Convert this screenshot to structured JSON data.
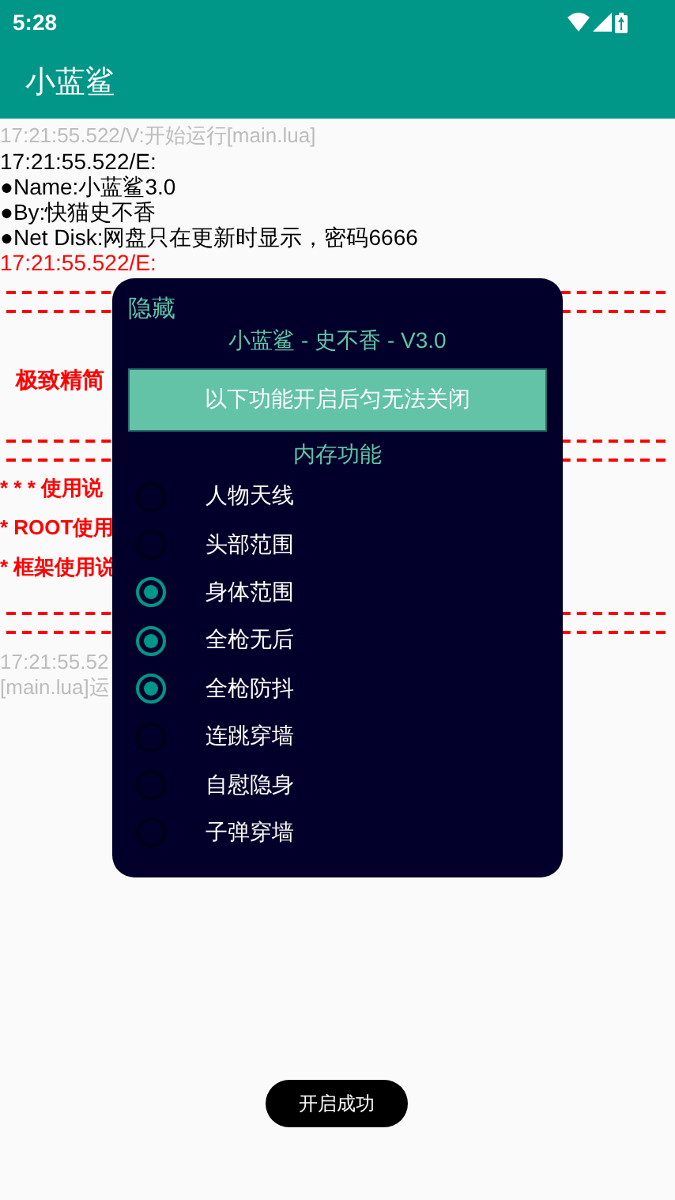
{
  "status_bar": {
    "time": "5:28"
  },
  "app_bar": {
    "title": "小蓝鲨"
  },
  "log": [
    {
      "kind": "info",
      "text": "17:21:55.522/V:开始运行[main.lua]"
    },
    {
      "kind": "plain",
      "text": "17:21:55.522/E:"
    },
    {
      "kind": "plain",
      "text": "●Name:小蓝鲨3.0"
    },
    {
      "kind": "plain",
      "text": "●By:快猫史不香"
    },
    {
      "kind": "plain",
      "text": "●Net Disk:网盘只在更新时显示，密码6666"
    },
    {
      "kind": "error",
      "text": "17:21:55.522/E:"
    },
    {
      "kind": "dashes"
    },
    {
      "kind": "note",
      "text": "极致精简"
    },
    {
      "kind": "dashes"
    },
    {
      "kind": "bullet",
      "text": "* * * 使用说"
    },
    {
      "kind": "bullet",
      "text": "* ROOT使用"
    },
    {
      "kind": "bullet",
      "text": "* 框架使用说"
    },
    {
      "kind": "dashes"
    },
    {
      "kind": "info",
      "text": "17:21:55.52"
    },
    {
      "kind": "info",
      "text": "[main.lua]运"
    }
  ],
  "dialog": {
    "hide": "隐藏",
    "title": "小蓝鲨 - 史不香 - V3.0",
    "banner": "以下功能开启后匀无法关闭",
    "section": "内存功能",
    "options": [
      {
        "label": "人物天线",
        "selected": false
      },
      {
        "label": "头部范围",
        "selected": false
      },
      {
        "label": "身体范围",
        "selected": true
      },
      {
        "label": "全枪无后",
        "selected": true
      },
      {
        "label": "全枪防抖",
        "selected": true
      },
      {
        "label": "连跳穿墙",
        "selected": false
      },
      {
        "label": "自慰隐身",
        "selected": false
      },
      {
        "label": "子弹穿墙",
        "selected": false
      }
    ]
  },
  "toast": "开启成功"
}
